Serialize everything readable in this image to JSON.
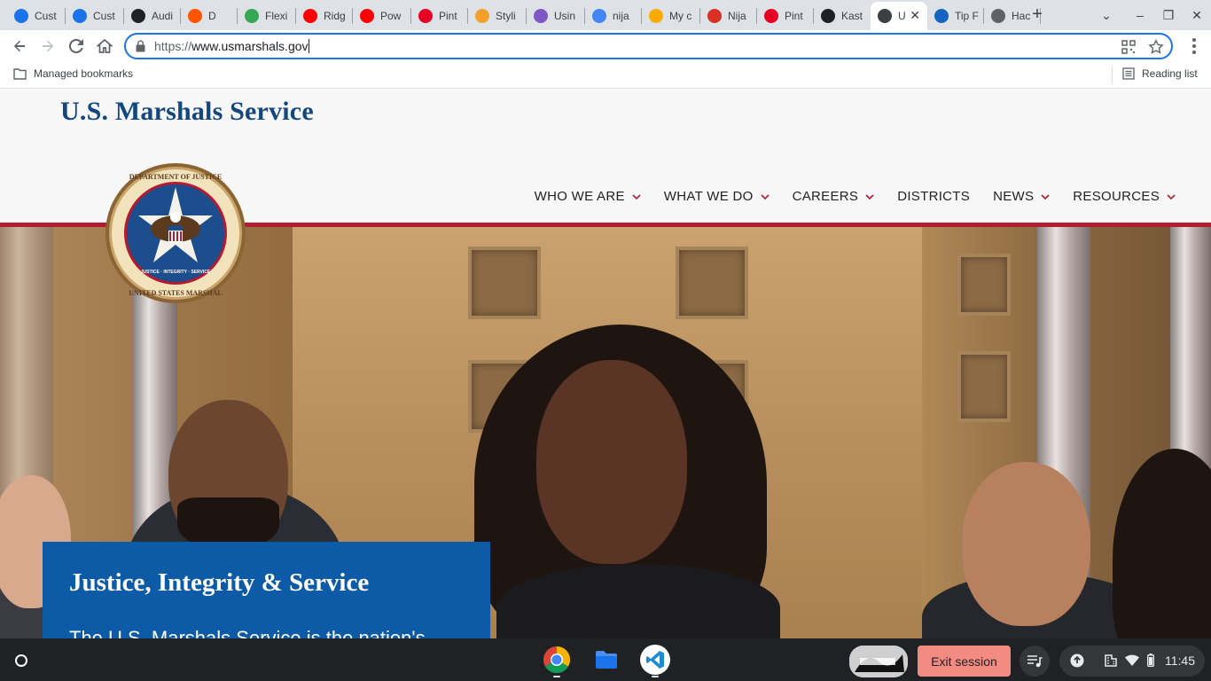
{
  "browser": {
    "tabs": [
      {
        "title": "Cust",
        "icon": "c-circle-icon",
        "color": "#1a73e8"
      },
      {
        "title": "Cust",
        "icon": "c-circle-icon",
        "color": "#1a73e8"
      },
      {
        "title": "Audi",
        "icon": "hex-icon",
        "color": "#202124"
      },
      {
        "title": "D",
        "icon": "soundcloud-icon",
        "color": "#ff5500"
      },
      {
        "title": "Flexi",
        "icon": "flexi-icon",
        "color": "#34a853"
      },
      {
        "title": "Ridg",
        "icon": "youtube-icon",
        "color": "#ff0000"
      },
      {
        "title": "Pow",
        "icon": "youtube-icon",
        "color": "#ff0000"
      },
      {
        "title": "Pint",
        "icon": "pinterest-icon",
        "color": "#e60023"
      },
      {
        "title": "Styli",
        "icon": "circle-icon",
        "color": "#f29f2c"
      },
      {
        "title": "Usin",
        "icon": "rocket-icon",
        "color": "#7e57c2"
      },
      {
        "title": "nija",
        "icon": "google-icon",
        "color": "#4285f4"
      },
      {
        "title": "My c",
        "icon": "sunglasses-icon",
        "color": "#f9ab00"
      },
      {
        "title": "Nija",
        "icon": "r-icon",
        "color": "#d93025"
      },
      {
        "title": "Pint",
        "icon": "pinterest-icon",
        "color": "#e60023"
      },
      {
        "title": "Kast",
        "icon": "kast-icon",
        "color": "#202124"
      },
      {
        "title": "U",
        "icon": "usms-icon",
        "color": "#3c4043",
        "active": true
      },
      {
        "title": "Tip F",
        "icon": "p-icon",
        "color": "#1565c0"
      },
      {
        "title": "Hac",
        "icon": "globe-icon",
        "color": "#5f6368"
      }
    ],
    "url_scheme": "https://",
    "url_host": "www.usmarshals.gov",
    "bookmarks_folder": "Managed bookmarks",
    "reading_list": "Reading list"
  },
  "site": {
    "title": "U.S. Marshals Service",
    "seal_alt": "Department of Justice United States Marshal seal",
    "seal_text": {
      "ring_top": "DEPARTMENT OF JUSTICE",
      "ring_bottom": "UNITED STATES MARSHAL",
      "year": "1789",
      "inner": "JUSTICE · INTEGRITY · SERVICE"
    },
    "nav": [
      {
        "label": "WHO WE ARE",
        "dropdown": true
      },
      {
        "label": "WHAT WE DO",
        "dropdown": true
      },
      {
        "label": "CAREERS",
        "dropdown": true
      },
      {
        "label": "DISTRICTS",
        "dropdown": false
      },
      {
        "label": "NEWS",
        "dropdown": true
      },
      {
        "label": "RESOURCES",
        "dropdown": true
      }
    ],
    "hero": {
      "heading": "Justice, Integrity & Service",
      "body": "The U.S. Marshals Service is the nation's"
    },
    "colors": {
      "brand_blue": "#13477f",
      "accent_red": "#b31b30",
      "hero_box": "#0d5ba6"
    }
  },
  "shelf": {
    "exit_label": "Exit session",
    "clock": "11:45"
  }
}
